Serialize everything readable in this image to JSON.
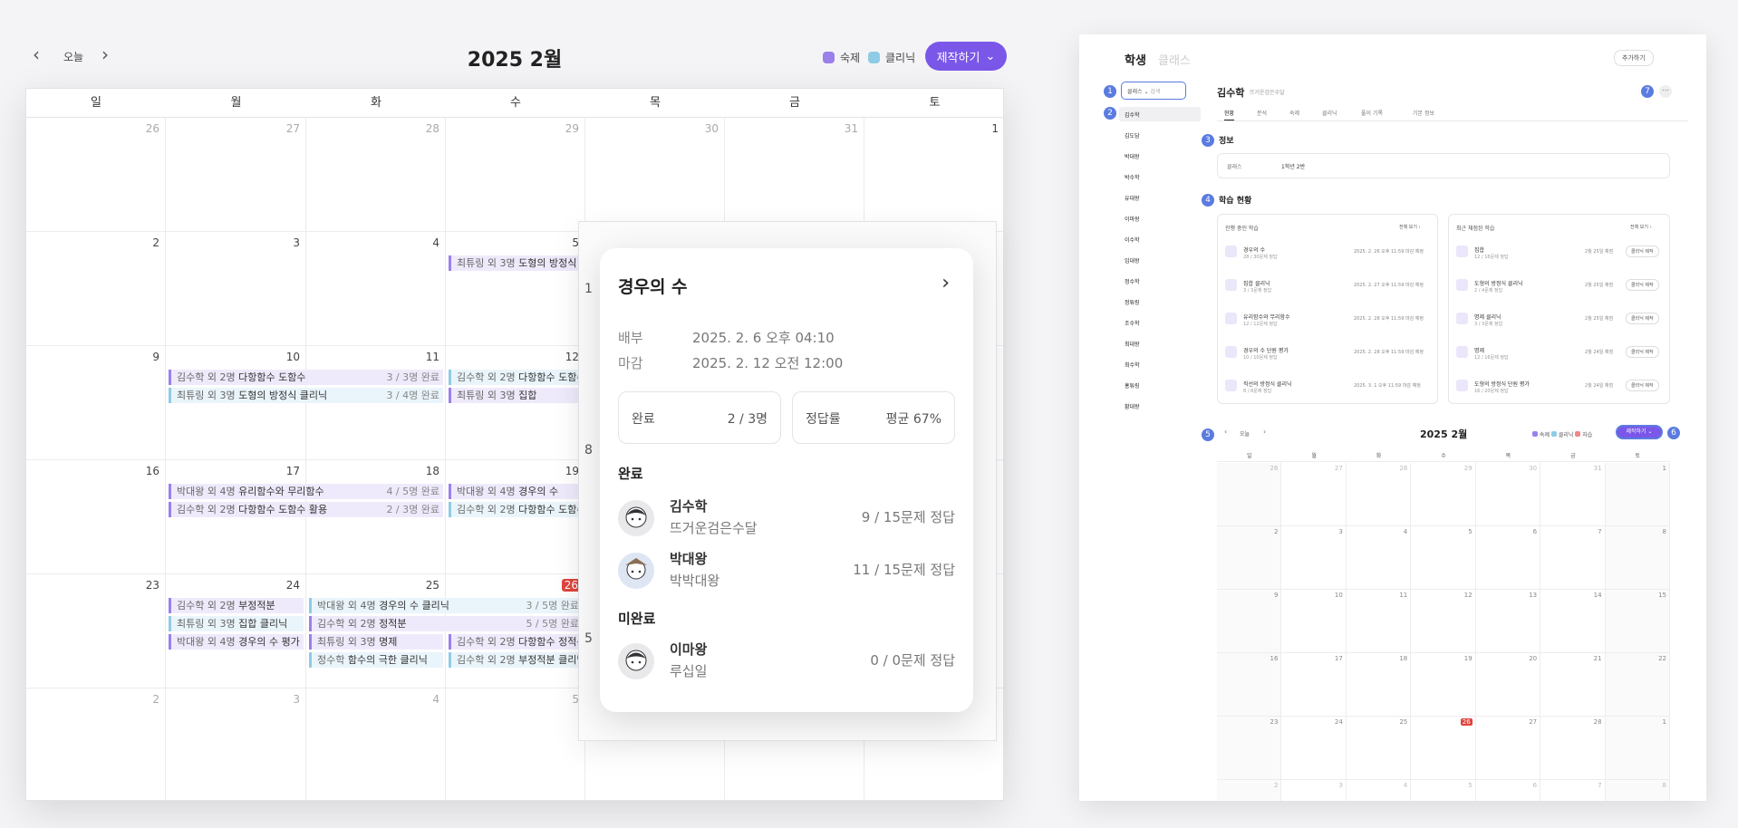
{
  "toolbar": {
    "today_label": "오늘",
    "title": "2025 2월",
    "legend": [
      {
        "label": "숙제",
        "color": "#9b80ea"
      },
      {
        "label": "클리닉",
        "color": "#8fcbe5"
      }
    ],
    "make_label": "제작하기"
  },
  "weekdays": [
    "일",
    "월",
    "화",
    "수",
    "목",
    "금",
    "토"
  ],
  "weeks": [
    [
      "26",
      "27",
      "28",
      "29",
      "30",
      "31",
      "1"
    ],
    [
      "2",
      "3",
      "4",
      "5",
      "",
      "",
      " "
    ],
    [
      "9",
      "10",
      "11",
      "12",
      "",
      "",
      ""
    ],
    [
      "16",
      "17",
      "18",
      "19",
      "",
      "",
      ""
    ],
    [
      "23",
      "24",
      "25",
      "26",
      "",
      "",
      ""
    ],
    [
      "2",
      "3",
      "4",
      "5",
      "",
      "",
      ""
    ]
  ],
  "events": {
    "w1_wed": {
      "prefix": "최튜링 외 3명",
      "title": "도형의 방정식 평"
    },
    "w2_mon_1": {
      "prefix": "김수학 외 2명",
      "title": "다항함수 도함수",
      "count": "3 / 3명 완료"
    },
    "w2_mon_2": {
      "prefix": "최튜링 외 3명",
      "title": "도형의 방정식 클리닉",
      "count": "3 / 4명 완료"
    },
    "w2_wed_1": {
      "prefix": "김수학 외 2명",
      "title": "다항함수 도함수"
    },
    "w2_wed_2": {
      "prefix": "최튜링 외 3명",
      "title": "집합"
    },
    "w3_mon_1": {
      "prefix": "박대왕 외 4명",
      "title": "유리함수와 무리함수",
      "count": "4 / 5명 완료"
    },
    "w3_mon_2": {
      "prefix": "김수학 외 2명",
      "title": "다항함수 도함수 활용",
      "count": "2 / 3명 완료"
    },
    "w3_wed_1": {
      "prefix": "박대왕 외 4명",
      "title": "경우의 수"
    },
    "w3_wed_2": {
      "prefix": "김수학 외 2명",
      "title": "다항함수 도함수"
    },
    "w4_mon_1": {
      "prefix": "김수학 외 2명",
      "title": "부정적분"
    },
    "w4_mon_2": {
      "prefix": "최튜링 외 3명",
      "title": "집합 클리닉"
    },
    "w4_mon_3": {
      "prefix": "박대왕 외 4명",
      "title": "경우의 수 평가"
    },
    "w4_tue_1": {
      "prefix": "박대왕 외 4명",
      "title": "경우의 수 클리닉",
      "count": "3 / 5명 완료"
    },
    "w4_tue_2": {
      "prefix": "김수학 외 2명",
      "title": "정적분",
      "count": "5 / 5명 완료"
    },
    "w4_tue_3": {
      "prefix": "최튜링 외 3명",
      "title": "명제"
    },
    "w4_tue_4": {
      "prefix": "정수학",
      "title": "함수의 극한 클리닉"
    },
    "w4_wed_1": {
      "prefix": "김수학 외 2명",
      "title": "다항함수 정적분"
    },
    "w4_wed_2": {
      "prefix": "김수학 외 2명",
      "title": "부정적분 클리닉"
    }
  },
  "back_popup_fragments": [
    "1",
    "8",
    "5"
  ],
  "popup": {
    "title": "경우의 수",
    "assigned_label": "배부",
    "assigned_value": "2025. 2. 6 오후 04:10",
    "due_label": "마감",
    "due_value": "2025. 2. 12 오전 12:00",
    "complete_label": "완료",
    "complete_value": "2 / 3명",
    "accuracy_label": "정답률",
    "accuracy_value": "평균 67%",
    "done_section": "완료",
    "undone_section": "미완료",
    "done": [
      {
        "name": "김수학",
        "school": "뜨거운검은수달",
        "result": "9 / 15문제 정답"
      },
      {
        "name": "박대왕",
        "school": "박박대왕",
        "result": "11 / 15문제 정답"
      }
    ],
    "undone": [
      {
        "name": "이마왕",
        "school": "루십일",
        "result": "0 / 0문제 정답"
      }
    ]
  },
  "right": {
    "tab_student": "학생",
    "tab_class": "클래스",
    "add_btn": "추가하기",
    "filter_label": "클래스",
    "filter_search": "검색",
    "students": [
      "김수학",
      "김도담",
      "박대왕",
      "박수학",
      "유대왕",
      "이마왕",
      "이수학",
      "임대왕",
      "정수학",
      "정튜링",
      "조수학",
      "최대왕",
      "최수학",
      "홍튜링",
      "황대왕"
    ],
    "selected_name": "김수학",
    "selected_school": "뜨거운검은수달",
    "detail_tabs": [
      "현황",
      "분석",
      "숙제",
      "클리닉",
      "풀이 기록",
      "기본 정보"
    ],
    "info_title": "정보",
    "class_label": "클래스",
    "class_value": "1학년 2반",
    "progress_title": "학습 현황",
    "ongoing_title": "진행 중인 학습",
    "recent_title": "최근 채점된 학습",
    "view_all": "전체 보기",
    "ongoing": [
      {
        "t": "경우의 수",
        "s": "28 / 30문제 정답",
        "d": "2025. 2. 26 오후 11:59 마감 예정"
      },
      {
        "t": "집합 클리닉",
        "s": "3 / 3문제 정답",
        "d": "2025. 2. 27 오후 11:59 마감 예정"
      },
      {
        "t": "유리함수와 무리함수",
        "s": "12 / 12문제 정답",
        "d": "2025. 2. 28 오후 11:59 마감 예정"
      },
      {
        "t": "경우의 수 단원 평가",
        "s": "10 / 10문제 정답",
        "d": "2025. 2. 28 오후 11:59 마감 예정"
      },
      {
        "t": "직선의 방정식 클리닉",
        "s": "8 / 8문제 정답",
        "d": "2025. 3. 1 오후 11:59 마감 예정"
      }
    ],
    "recent": [
      {
        "t": "집합",
        "s": "12 / 16문제 정답",
        "d": "2월 25일 채점"
      },
      {
        "t": "도형의 방정식 클리닉",
        "s": "2 / 4문제 정답",
        "d": "2월 25일 채점"
      },
      {
        "t": "명제 클리닉",
        "s": "3 / 3문제 정답",
        "d": "2월 25일 채점"
      },
      {
        "t": "명제",
        "s": "12 / 16문제 정답",
        "d": "2월 24일 채점"
      },
      {
        "t": "도형의 방정식 단원 평가",
        "s": "16 / 20문제 정답",
        "d": "2월 24일 채점"
      }
    ],
    "make_clinic": "클리닉 제작",
    "cal_title": "2025 2월",
    "cal_today": "오늘",
    "cal_legend": [
      "숙제",
      "클리닉",
      "자습"
    ],
    "cal_make": "제작하기",
    "badges": [
      "1",
      "2",
      "3",
      "4",
      "5",
      "6",
      "7"
    ]
  }
}
